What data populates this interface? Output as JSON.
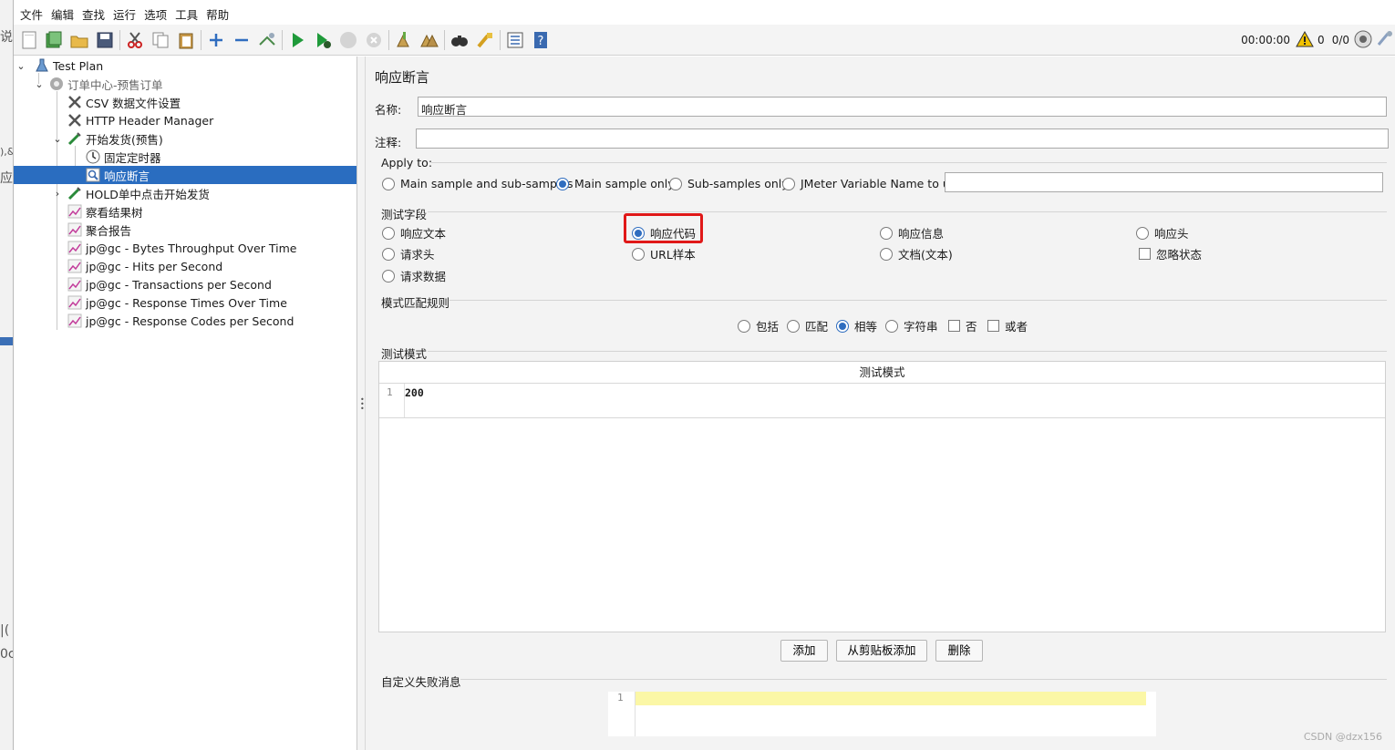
{
  "left_fragments": [
    "说",
    "),&",
    "应",
    "|(",
    "0c"
  ],
  "menu": [
    "文件",
    "编辑",
    "查找",
    "运行",
    "选项",
    "工具",
    "帮助"
  ],
  "toolbar": {
    "icons": [
      "new-icon",
      "templates-icon",
      "open-icon",
      "save-icon",
      "cut-icon",
      "copy-icon",
      "paste-icon",
      "expand-icon",
      "collapse-icon",
      "toggle-icon",
      "start-icon",
      "start-no-pause-icon",
      "stop-icon",
      "shutdown-icon",
      "clear-icon",
      "clear-all-icon",
      "search-icon",
      "reset-search-icon",
      "function-helper-icon",
      "help-icon"
    ],
    "timer": "00:00:00",
    "warn_count": "0",
    "threads": "0/0"
  },
  "tree": {
    "items": [
      {
        "label": "Test Plan",
        "icon": "flask-icon"
      },
      {
        "label": "订单中心-预售订单",
        "icon": "gear-icon"
      },
      {
        "label": "CSV 数据文件设置",
        "icon": "tools-icon"
      },
      {
        "label": "HTTP Header Manager",
        "icon": "tools-icon"
      },
      {
        "label": "开始发货(预售)",
        "icon": "sampler-icon"
      },
      {
        "label": "固定定时器",
        "icon": "timer-icon"
      },
      {
        "label": "响应断言",
        "icon": "assertion-icon"
      },
      {
        "label": "HOLD单中点击开始发货",
        "icon": "sampler-icon"
      },
      {
        "label": "察看结果树",
        "icon": "listener-icon"
      },
      {
        "label": "聚合报告",
        "icon": "listener-icon"
      },
      {
        "label": "jp@gc - Bytes Throughput Over Time",
        "icon": "listener-icon"
      },
      {
        "label": "jp@gc - Hits per Second",
        "icon": "listener-icon"
      },
      {
        "label": "jp@gc - Transactions per Second",
        "icon": "listener-icon"
      },
      {
        "label": "jp@gc - Response Times Over Time",
        "icon": "listener-icon"
      },
      {
        "label": "jp@gc - Response Codes per Second",
        "icon": "listener-icon"
      }
    ]
  },
  "panel": {
    "title": "响应断言",
    "name_label": "名称:",
    "name_value": "响应断言",
    "comment_label": "注释:",
    "comment_value": "",
    "apply_to": {
      "label": "Apply to:",
      "options": [
        "Main sample and sub-samples",
        "Main sample only",
        "Sub-samples only",
        "JMeter Variable Name to use"
      ],
      "selected": "Main sample only",
      "variable_value": ""
    },
    "test_field": {
      "label": "测试字段",
      "options": [
        "响应文本",
        "响应代码",
        "响应信息",
        "响应头",
        "请求头",
        "URL样本",
        "文档(文本)",
        "请求数据"
      ],
      "checkbox": "忽略状态",
      "selected": "响应代码"
    },
    "match_rule": {
      "label": "模式匹配规则",
      "radios": [
        "包括",
        "匹配",
        "相等",
        "字符串"
      ],
      "selected": "相等",
      "checks": [
        "否",
        "或者"
      ]
    },
    "patterns": {
      "label": "测试模式",
      "column": "测试模式",
      "rows": [
        {
          "line": "1",
          "value": "200"
        }
      ]
    },
    "buttons": {
      "add": "添加",
      "add_clipboard": "从剪贴板添加",
      "delete": "删除"
    },
    "failure_message": {
      "label": "自定义失败消息",
      "line": "1",
      "value": ""
    }
  },
  "watermark": "CSDN @dzx156"
}
